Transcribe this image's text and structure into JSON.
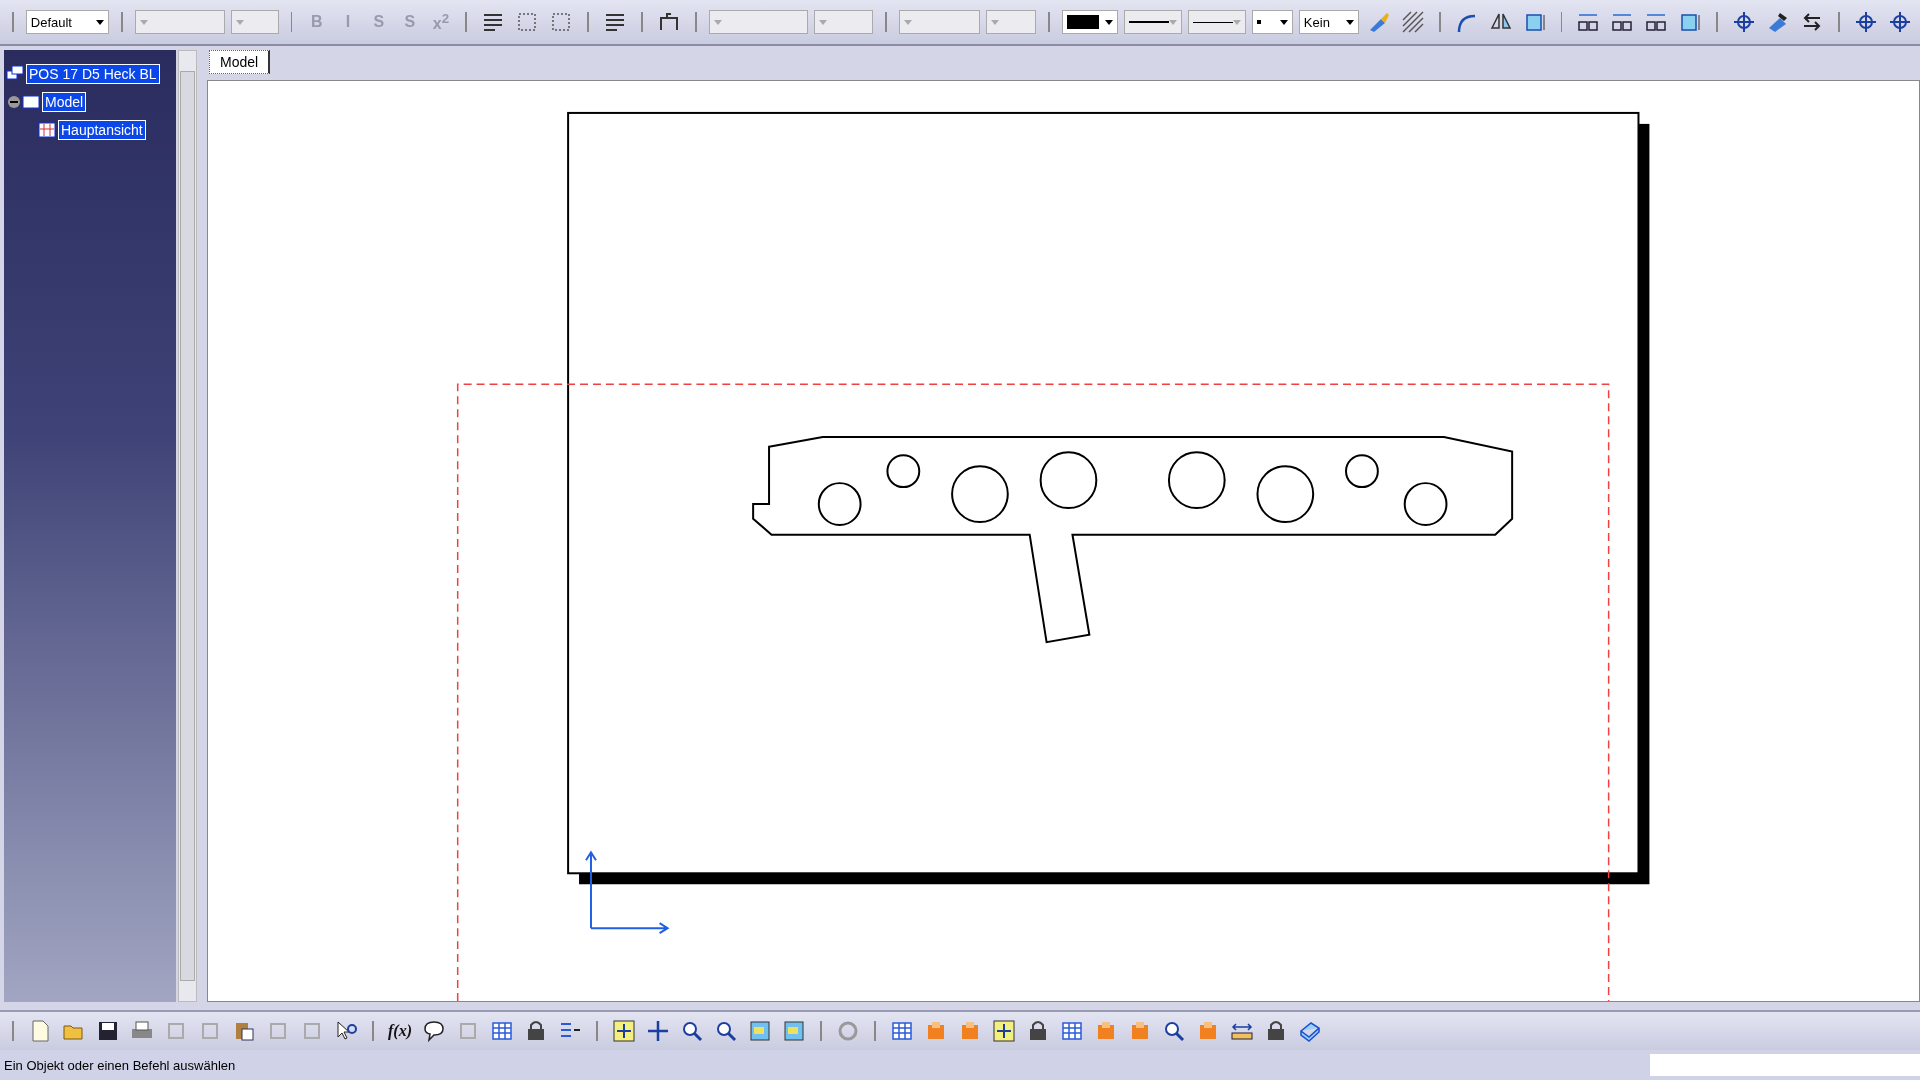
{
  "toolbar": {
    "style_dropdown": "Default",
    "text_format_buttons": [
      {
        "label": "B",
        "disabled": true
      },
      {
        "label": "I",
        "disabled": true
      },
      {
        "label": "S",
        "disabled": true
      },
      {
        "label": "S",
        "disabled": true
      },
      {
        "label": "x$^{2}$",
        "disabled": true
      }
    ],
    "fill_dropdown": "Kein"
  },
  "tree": {
    "label": "POS 17 D5 Heck BL",
    "selected": true,
    "children": [
      {
        "label": "Model",
        "selected": true,
        "expanded": true,
        "children": [
          {
            "label": "Hauptansicht",
            "selected": true
          }
        ]
      }
    ]
  },
  "sheet_tabs": [
    {
      "label": "Model",
      "selected": true
    }
  ],
  "bottom_toolbar": {
    "formula_button": "f(x)"
  },
  "status_bar": {
    "message": "Ein Objekt oder einen Befehl auswählen"
  }
}
